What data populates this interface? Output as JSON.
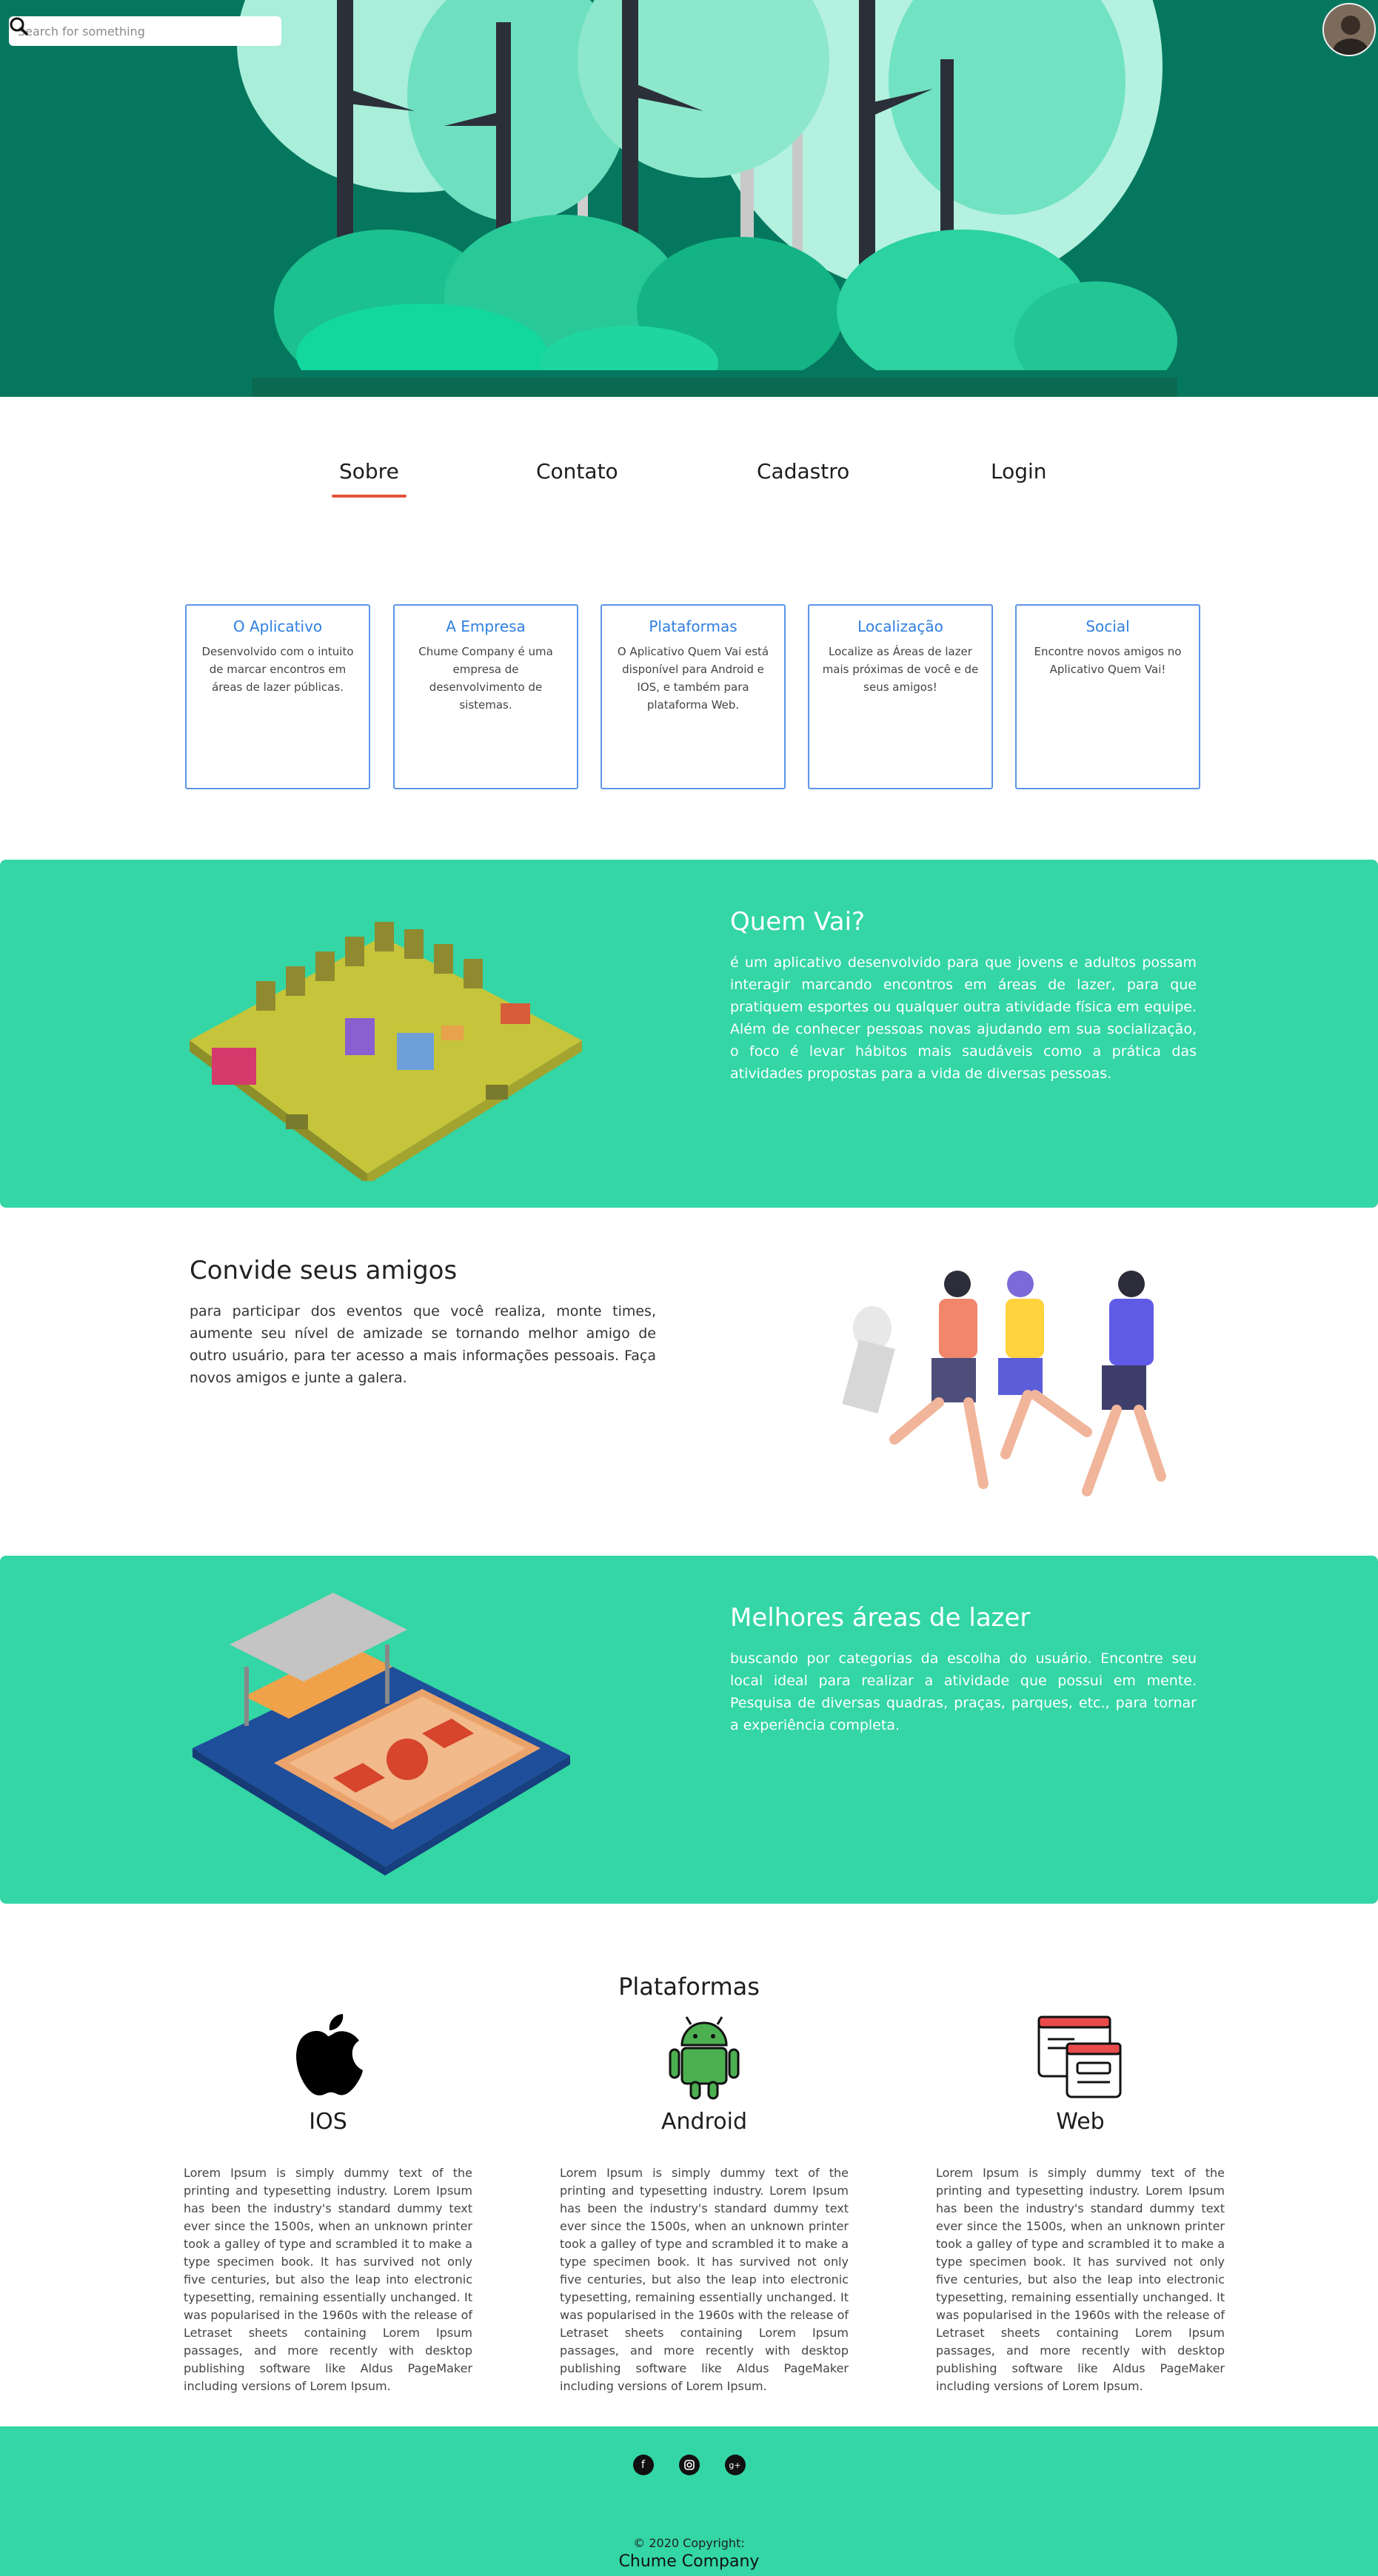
{
  "header": {
    "search_placeholder": "Search for something",
    "search_icon": "search-icon",
    "avatar_icon": "user-avatar"
  },
  "nav": {
    "items": [
      "Sobre",
      "Contato",
      "Cadastro",
      "Login"
    ],
    "active": "Sobre"
  },
  "features": [
    {
      "title": "O Aplicativo",
      "text": "Desenvolvido com o intuito de marcar encontros em áreas de lazer públicas."
    },
    {
      "title": "A Empresa",
      "text": "Chume Company é uma empresa de desenvolvimento de sistemas."
    },
    {
      "title": "Plataformas",
      "text": "O Aplicativo Quem Vai está disponível para Android e IOS, e também para plataforma Web."
    },
    {
      "title": "Localização",
      "text": "Localize as Áreas de lazer mais próximas de você e de seus amigos!"
    },
    {
      "title": "Social",
      "text": "Encontre novos amigos no Aplicativo Quem Vai!"
    }
  ],
  "about": {
    "title": "Quem Vai?",
    "text": "é um aplicativo desenvolvido para que jovens e adultos possam interagir marcando encontros em áreas de lazer, para que pratiquem esportes ou qualquer outra atividade física em equipe. Além de conhecer pessoas novas ajudando em sua socialização, o foco é levar hábitos mais saudáveis como a prática das atividades propostas para a vida de diversas pessoas."
  },
  "invite": {
    "title": "Convide seus amigos",
    "text": "para participar dos eventos que você realiza, monte times, aumente seu nível de amizade se tornando melhor amigo de outro usuário, para ter acesso a mais informações pessoais. Faça novos amigos e junte a galera."
  },
  "areas": {
    "title": "Melhores áreas de lazer",
    "text": "buscando por categorias da escolha do usuário. Encontre seu local ideal para realizar a atividade que possui em mente. Pesquisa de diversas quadras, praças, parques, etc., para tornar a experiência completa."
  },
  "platforms": {
    "heading": "Plataformas",
    "items": [
      {
        "name": "IOS",
        "icon": "apple-icon",
        "text": "Lorem Ipsum is simply dummy text of the printing and typesetting industry. Lorem Ipsum has been the industry's standard dummy text ever since the 1500s, when an unknown printer took a galley of type and scrambled it to make a type specimen book. It has survived not only five centuries, but also the leap into electronic typesetting, remaining essentially unchanged. It was popularised in the 1960s with the release of Letraset sheets containing Lorem Ipsum passages, and more recently with desktop publishing software like Aldus PageMaker including versions of Lorem Ipsum."
      },
      {
        "name": "Android",
        "icon": "android-icon",
        "text": "Lorem Ipsum is simply dummy text of the printing and typesetting industry. Lorem Ipsum has been the industry's standard dummy text ever since the 1500s, when an unknown printer took a galley of type and scrambled it to make a type specimen book. It has survived not only five centuries, but also the leap into electronic typesetting, remaining essentially unchanged. It was popularised in the 1960s with the release of Letraset sheets containing Lorem Ipsum passages, and more recently with desktop publishing software like Aldus PageMaker including versions of Lorem Ipsum."
      },
      {
        "name": "Web",
        "icon": "web-browser-icon",
        "text": "Lorem Ipsum is simply dummy text of the printing and typesetting industry. Lorem Ipsum has been the industry's standard dummy text ever since the 1500s, when an unknown printer took a galley of type and scrambled it to make a type specimen book. It has survived not only five centuries, but also the leap into electronic typesetting, remaining essentially unchanged. It was popularised in the 1960s with the release of Letraset sheets containing Lorem Ipsum passages, and more recently with desktop publishing software like Aldus PageMaker including versions of Lorem Ipsum."
      }
    ]
  },
  "footer": {
    "social_icons": [
      "facebook-icon",
      "instagram-icon",
      "google-plus-icon"
    ],
    "copyright": "© 2020 Copyright:",
    "company": "Chume Company"
  },
  "colors": {
    "hero_bg": "#06775f",
    "accent_green": "#33d6a4",
    "card_border": "#5c95e6",
    "card_title": "#2f7fe0",
    "nav_underline": "#e2533a"
  }
}
